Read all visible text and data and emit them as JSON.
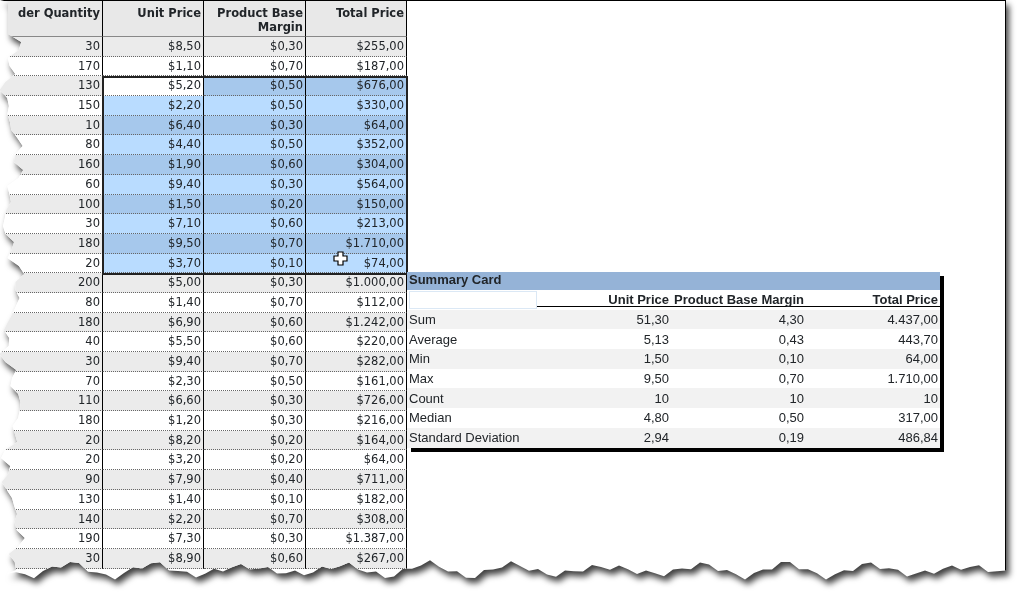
{
  "sheet": {
    "columns": [
      "der Quantity",
      "Unit Price",
      "Product Base Margin",
      "Total Price"
    ],
    "rows": [
      {
        "cells": [
          "30",
          "$8,50",
          "$0,30",
          "$255,00"
        ],
        "selected": false,
        "active": false
      },
      {
        "cells": [
          "170",
          "$1,10",
          "$0,70",
          "$187,00"
        ],
        "selected": false,
        "active": false
      },
      {
        "cells": [
          "130",
          "$5,20",
          "$0,50",
          "$676,00"
        ],
        "selected": true,
        "active": true
      },
      {
        "cells": [
          "150",
          "$2,20",
          "$0,50",
          "$330,00"
        ],
        "selected": true,
        "active": false
      },
      {
        "cells": [
          "10",
          "$6,40",
          "$0,30",
          "$64,00"
        ],
        "selected": true,
        "active": false
      },
      {
        "cells": [
          "80",
          "$4,40",
          "$0,50",
          "$352,00"
        ],
        "selected": true,
        "active": false
      },
      {
        "cells": [
          "160",
          "$1,90",
          "$0,60",
          "$304,00"
        ],
        "selected": true,
        "active": false
      },
      {
        "cells": [
          "60",
          "$9,40",
          "$0,30",
          "$564,00"
        ],
        "selected": true,
        "active": false
      },
      {
        "cells": [
          "100",
          "$1,50",
          "$0,20",
          "$150,00"
        ],
        "selected": true,
        "active": false
      },
      {
        "cells": [
          "30",
          "$7,10",
          "$0,60",
          "$213,00"
        ],
        "selected": true,
        "active": false
      },
      {
        "cells": [
          "180",
          "$9,50",
          "$0,70",
          "$1.710,00"
        ],
        "selected": true,
        "active": false
      },
      {
        "cells": [
          "20",
          "$3,70",
          "$0,10",
          "$74,00"
        ],
        "selected": true,
        "active": false
      },
      {
        "cells": [
          "200",
          "$5,00",
          "$0,30",
          "$1.000,00"
        ],
        "selected": false,
        "active": false
      },
      {
        "cells": [
          "80",
          "$1,40",
          "$0,70",
          "$112,00"
        ],
        "selected": false,
        "active": false
      },
      {
        "cells": [
          "180",
          "$6,90",
          "$0,60",
          "$1.242,00"
        ],
        "selected": false,
        "active": false
      },
      {
        "cells": [
          "40",
          "$5,50",
          "$0,60",
          "$220,00"
        ],
        "selected": false,
        "active": false
      },
      {
        "cells": [
          "30",
          "$9,40",
          "$0,70",
          "$282,00"
        ],
        "selected": false,
        "active": false
      },
      {
        "cells": [
          "70",
          "$2,30",
          "$0,50",
          "$161,00"
        ],
        "selected": false,
        "active": false
      },
      {
        "cells": [
          "110",
          "$6,60",
          "$0,30",
          "$726,00"
        ],
        "selected": false,
        "active": false
      },
      {
        "cells": [
          "180",
          "$1,20",
          "$0,30",
          "$216,00"
        ],
        "selected": false,
        "active": false
      },
      {
        "cells": [
          "20",
          "$8,20",
          "$0,20",
          "$164,00"
        ],
        "selected": false,
        "active": false
      },
      {
        "cells": [
          "20",
          "$3,20",
          "$0,20",
          "$64,00"
        ],
        "selected": false,
        "active": false
      },
      {
        "cells": [
          "90",
          "$7,90",
          "$0,40",
          "$711,00"
        ],
        "selected": false,
        "active": false
      },
      {
        "cells": [
          "130",
          "$1,40",
          "$0,10",
          "$182,00"
        ],
        "selected": false,
        "active": false
      },
      {
        "cells": [
          "140",
          "$2,20",
          "$0,70",
          "$308,00"
        ],
        "selected": false,
        "active": false
      },
      {
        "cells": [
          "190",
          "$7,30",
          "$0,30",
          "$1.387,00"
        ],
        "selected": false,
        "active": false
      },
      {
        "cells": [
          "30",
          "$8,90",
          "$0,60",
          "$267,00"
        ],
        "selected": false,
        "active": false
      }
    ]
  },
  "summary_card": {
    "title": "Summary Card",
    "columns": [
      "Unit Price",
      "Product Base Margin",
      "Total Price"
    ],
    "rows": [
      {
        "label": "Sum",
        "values": [
          "51,30",
          "4,30",
          "4.437,00"
        ]
      },
      {
        "label": "Average",
        "values": [
          "5,13",
          "0,43",
          "443,70"
        ]
      },
      {
        "label": "Min",
        "values": [
          "1,50",
          "0,10",
          "64,00"
        ]
      },
      {
        "label": "Max",
        "values": [
          "9,50",
          "0,70",
          "1.710,00"
        ]
      },
      {
        "label": "Count",
        "values": [
          "10",
          "10",
          "10"
        ]
      },
      {
        "label": "Median",
        "values": [
          "4,80",
          "0,50",
          "317,00"
        ]
      },
      {
        "label": "Standard Deviation",
        "values": [
          "2,94",
          "0,19",
          "486,84"
        ]
      }
    ]
  }
}
